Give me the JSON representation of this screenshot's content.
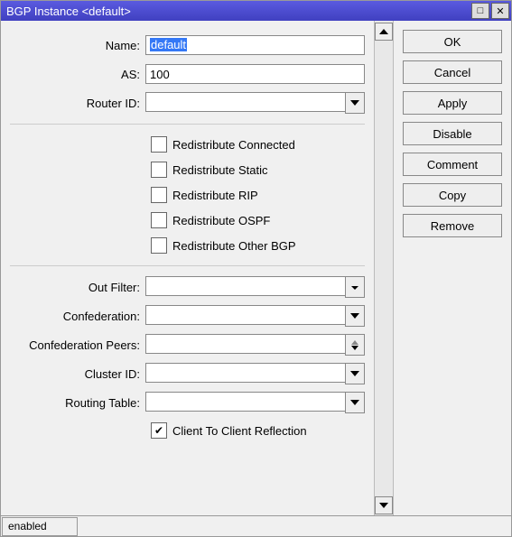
{
  "window": {
    "title": "BGP Instance <default>"
  },
  "fields": {
    "name_label": "Name:",
    "name_value": "default",
    "as_label": "AS:",
    "as_value": "100",
    "routerid_label": "Router ID:",
    "routerid_value": "",
    "outfilter_label": "Out Filter:",
    "outfilter_value": "",
    "confed_label": "Confederation:",
    "confed_value": "",
    "confedpeers_label": "Confederation Peers:",
    "confedpeers_value": "",
    "clusterid_label": "Cluster ID:",
    "clusterid_value": "",
    "routingtable_label": "Routing Table:",
    "routingtable_value": ""
  },
  "checks": {
    "redist_connected": "Redistribute Connected",
    "redist_static": "Redistribute Static",
    "redist_rip": "Redistribute RIP",
    "redist_ospf": "Redistribute OSPF",
    "redist_otherbgp": "Redistribute Other BGP",
    "client_reflection": "Client To Client Reflection"
  },
  "buttons": {
    "ok": "OK",
    "cancel": "Cancel",
    "apply": "Apply",
    "disable": "Disable",
    "comment": "Comment",
    "copy": "Copy",
    "remove": "Remove"
  },
  "status": {
    "text": "enabled"
  }
}
